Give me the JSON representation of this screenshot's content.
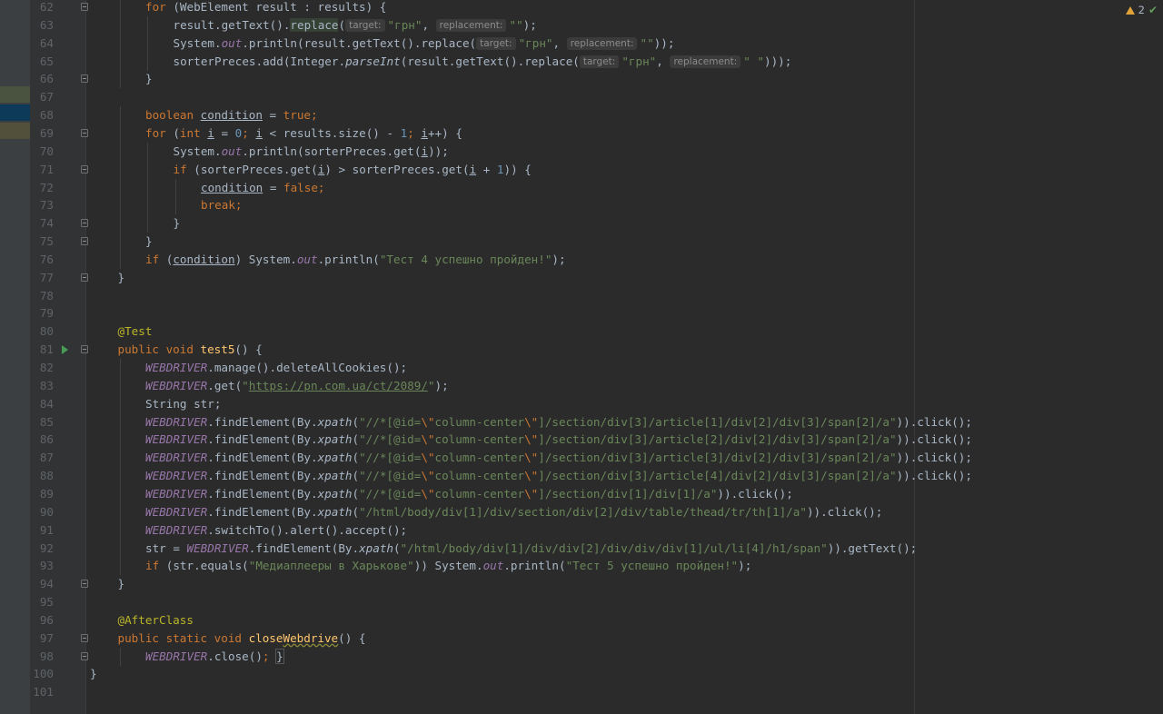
{
  "status": {
    "warnings_count": "2",
    "warning_icon": "warning-triangle-icon",
    "check_icon": "check-icon"
  },
  "colors": {
    "keyword": "#cc7832",
    "string": "#6a8759",
    "number": "#6897bb",
    "annotation": "#bbb529",
    "method_decl": "#ffc66d",
    "static_field": "#9876aa",
    "text": "#a9b7c6",
    "line_number": "#606366",
    "background": "#2b2b2b"
  },
  "hints": {
    "target": "target:",
    "replacement": "replacement:"
  },
  "lines": [
    {
      "num": "62",
      "indent": 2,
      "tokens": [
        [
          "k",
          "for"
        ],
        [
          "t",
          " (WebElement result : results) {"
        ]
      ]
    },
    {
      "num": "63",
      "indent": 3,
      "tokens": [
        [
          "t",
          "result.getText()."
        ],
        [
          "hl",
          "replace"
        ],
        [
          "t",
          "("
        ],
        [
          "hint",
          "target:"
        ],
        [
          "s",
          "\"грн\""
        ],
        [
          "t",
          ", "
        ],
        [
          "hint",
          "replacement:"
        ],
        [
          "s",
          "\"\""
        ],
        [
          "t",
          ");"
        ]
      ]
    },
    {
      "num": "64",
      "indent": 3,
      "tokens": [
        [
          "t",
          "System."
        ],
        [
          "si",
          "out"
        ],
        [
          "t",
          ".println(result.getText().replace("
        ],
        [
          "hint",
          "target:"
        ],
        [
          "s",
          "\"грн\""
        ],
        [
          "t",
          ", "
        ],
        [
          "hint",
          "replacement:"
        ],
        [
          "s",
          "\"\""
        ],
        [
          "t",
          "));"
        ]
      ]
    },
    {
      "num": "65",
      "indent": 3,
      "tokens": [
        [
          "t",
          "sorterPreces.add(Integer."
        ],
        [
          "fi",
          "parseInt"
        ],
        [
          "t",
          "(result.getText().replace("
        ],
        [
          "hint",
          "target:"
        ],
        [
          "s",
          "\"грн\""
        ],
        [
          "t",
          ", "
        ],
        [
          "hint",
          "replacement:"
        ],
        [
          "s",
          "\" \""
        ],
        [
          "t",
          ")));"
        ]
      ]
    },
    {
      "num": "66",
      "indent": 2,
      "tokens": [
        [
          "t",
          "}"
        ]
      ]
    },
    {
      "num": "67",
      "indent": 0,
      "tokens": []
    },
    {
      "num": "68",
      "indent": 2,
      "tokens": [
        [
          "k",
          "boolean "
        ],
        [
          "u",
          "condition"
        ],
        [
          "t",
          " = "
        ],
        [
          "k",
          "true"
        ],
        [
          "k",
          ";"
        ]
      ]
    },
    {
      "num": "69",
      "indent": 2,
      "tokens": [
        [
          "k",
          "for"
        ],
        [
          "t",
          " ("
        ],
        [
          "k",
          "int "
        ],
        [
          "u",
          "i"
        ],
        [
          "t",
          " = "
        ],
        [
          "n",
          "0"
        ],
        [
          "k",
          "; "
        ],
        [
          "u",
          "i"
        ],
        [
          "t",
          " < results.size() - "
        ],
        [
          "n",
          "1"
        ],
        [
          "k",
          "; "
        ],
        [
          "u",
          "i"
        ],
        [
          "t",
          "++) {"
        ]
      ]
    },
    {
      "num": "70",
      "indent": 3,
      "tokens": [
        [
          "t",
          "System."
        ],
        [
          "si",
          "out"
        ],
        [
          "t",
          ".println(sorterPreces.get("
        ],
        [
          "u",
          "i"
        ],
        [
          "t",
          "));"
        ]
      ]
    },
    {
      "num": "71",
      "indent": 3,
      "tokens": [
        [
          "k",
          "if"
        ],
        [
          "t",
          " (sorterPreces.get("
        ],
        [
          "u",
          "i"
        ],
        [
          "t",
          ") > sorterPreces.get("
        ],
        [
          "u",
          "i"
        ],
        [
          "t",
          " + "
        ],
        [
          "n",
          "1"
        ],
        [
          "t",
          ")) {"
        ]
      ]
    },
    {
      "num": "72",
      "indent": 4,
      "tokens": [
        [
          "u",
          "condition"
        ],
        [
          "t",
          " = "
        ],
        [
          "k",
          "false"
        ],
        [
          "k",
          ";"
        ]
      ]
    },
    {
      "num": "73",
      "indent": 4,
      "tokens": [
        [
          "k",
          "break;"
        ]
      ]
    },
    {
      "num": "74",
      "indent": 3,
      "tokens": [
        [
          "t",
          "}"
        ]
      ]
    },
    {
      "num": "75",
      "indent": 2,
      "tokens": [
        [
          "t",
          "}"
        ]
      ]
    },
    {
      "num": "76",
      "indent": 2,
      "tokens": [
        [
          "k",
          "if"
        ],
        [
          "t",
          " ("
        ],
        [
          "u",
          "condition"
        ],
        [
          "t",
          ") System."
        ],
        [
          "si",
          "out"
        ],
        [
          "t",
          ".println("
        ],
        [
          "s",
          "\"Тест 4 успешно пройден!\""
        ],
        [
          "t",
          ");"
        ]
      ]
    },
    {
      "num": "77",
      "indent": 1,
      "tokens": [
        [
          "t",
          "}"
        ]
      ]
    },
    {
      "num": "78",
      "indent": 0,
      "tokens": []
    },
    {
      "num": "79",
      "indent": 0,
      "tokens": []
    },
    {
      "num": "80",
      "indent": 1,
      "tokens": [
        [
          "a",
          "@Test"
        ]
      ]
    },
    {
      "num": "81",
      "indent": 1,
      "run": true,
      "tokens": [
        [
          "k",
          "public void "
        ],
        [
          "f",
          "test5"
        ],
        [
          "t",
          "() {"
        ]
      ]
    },
    {
      "num": "82",
      "indent": 2,
      "tokens": [
        [
          "si",
          "WEBDRIVER"
        ],
        [
          "t",
          ".manage().deleteAllCookies();"
        ]
      ]
    },
    {
      "num": "83",
      "indent": 2,
      "tokens": [
        [
          "si",
          "WEBDRIVER"
        ],
        [
          "t",
          ".get("
        ],
        [
          "s",
          "\""
        ],
        [
          "su",
          "https://pn.com.ua/ct/2089/"
        ],
        [
          "s",
          "\""
        ],
        [
          "t",
          ");"
        ]
      ]
    },
    {
      "num": "84",
      "indent": 2,
      "tokens": [
        [
          "t",
          "String str;"
        ]
      ]
    },
    {
      "num": "85",
      "indent": 2,
      "tokens": [
        [
          "si",
          "WEBDRIVER"
        ],
        [
          "t",
          ".findElement(By."
        ],
        [
          "fi",
          "xpath"
        ],
        [
          "t",
          "("
        ],
        [
          "s",
          "\"//*[@id="
        ],
        [
          "e",
          "\\\""
        ],
        [
          "s",
          "column-center"
        ],
        [
          "e",
          "\\\""
        ],
        [
          "s",
          "]/section/div[3]/article[1]/div[2]/div[3]/span[2]/a\""
        ],
        [
          "t",
          ")).click();"
        ]
      ]
    },
    {
      "num": "86",
      "indent": 2,
      "tokens": [
        [
          "si",
          "WEBDRIVER"
        ],
        [
          "t",
          ".findElement(By."
        ],
        [
          "fi",
          "xpath"
        ],
        [
          "t",
          "("
        ],
        [
          "s",
          "\"//*[@id="
        ],
        [
          "e",
          "\\\""
        ],
        [
          "s",
          "column-center"
        ],
        [
          "e",
          "\\\""
        ],
        [
          "s",
          "]/section/div[3]/article[2]/div[2]/div[3]/span[2]/a\""
        ],
        [
          "t",
          ")).click();"
        ]
      ]
    },
    {
      "num": "87",
      "indent": 2,
      "tokens": [
        [
          "si",
          "WEBDRIVER"
        ],
        [
          "t",
          ".findElement(By."
        ],
        [
          "fi",
          "xpath"
        ],
        [
          "t",
          "("
        ],
        [
          "s",
          "\"//*[@id="
        ],
        [
          "e",
          "\\\""
        ],
        [
          "s",
          "column-center"
        ],
        [
          "e",
          "\\\""
        ],
        [
          "s",
          "]/section/div[3]/article[3]/div[2]/div[3]/span[2]/a\""
        ],
        [
          "t",
          ")).click();"
        ]
      ]
    },
    {
      "num": "88",
      "indent": 2,
      "tokens": [
        [
          "si",
          "WEBDRIVER"
        ],
        [
          "t",
          ".findElement(By."
        ],
        [
          "fi",
          "xpath"
        ],
        [
          "t",
          "("
        ],
        [
          "s",
          "\"//*[@id="
        ],
        [
          "e",
          "\\\""
        ],
        [
          "s",
          "column-center"
        ],
        [
          "e",
          "\\\""
        ],
        [
          "s",
          "]/section/div[3]/article[4]/div[2]/div[3]/span[2]/a\""
        ],
        [
          "t",
          ")).click();"
        ]
      ]
    },
    {
      "num": "89",
      "indent": 2,
      "tokens": [
        [
          "si",
          "WEBDRIVER"
        ],
        [
          "t",
          ".findElement(By."
        ],
        [
          "fi",
          "xpath"
        ],
        [
          "t",
          "("
        ],
        [
          "s",
          "\"//*[@id="
        ],
        [
          "e",
          "\\\""
        ],
        [
          "s",
          "column-center"
        ],
        [
          "e",
          "\\\""
        ],
        [
          "s",
          "]/section/div[1]/div[1]/a\""
        ],
        [
          "t",
          ")).click();"
        ]
      ]
    },
    {
      "num": "90",
      "indent": 2,
      "tokens": [
        [
          "si",
          "WEBDRIVER"
        ],
        [
          "t",
          ".findElement(By."
        ],
        [
          "fi",
          "xpath"
        ],
        [
          "t",
          "("
        ],
        [
          "s",
          "\"/html/body/div[1]/div/section/div[2]/div/table/thead/tr/th[1]/a\""
        ],
        [
          "t",
          ")).click();"
        ]
      ]
    },
    {
      "num": "91",
      "indent": 2,
      "tokens": [
        [
          "si",
          "WEBDRIVER"
        ],
        [
          "t",
          ".switchTo().alert().accept();"
        ]
      ]
    },
    {
      "num": "92",
      "indent": 2,
      "tokens": [
        [
          "t",
          "str = "
        ],
        [
          "si",
          "WEBDRIVER"
        ],
        [
          "t",
          ".findElement(By."
        ],
        [
          "fi",
          "xpath"
        ],
        [
          "t",
          "("
        ],
        [
          "s",
          "\"/html/body/div[1]/div/div[2]/div/div/div[1]/ul/li[4]/h1/span\""
        ],
        [
          "t",
          ")).getText();"
        ]
      ]
    },
    {
      "num": "93",
      "indent": 2,
      "tokens": [
        [
          "k",
          "if"
        ],
        [
          "t",
          " (str.equals("
        ],
        [
          "s",
          "\"Медиаплееры в Харькове\""
        ],
        [
          "t",
          ")) System."
        ],
        [
          "si",
          "out"
        ],
        [
          "t",
          ".println("
        ],
        [
          "s",
          "\"Тест 5 успешно пройден!\""
        ],
        [
          "t",
          ");"
        ]
      ]
    },
    {
      "num": "94",
      "indent": 1,
      "tokens": [
        [
          "t",
          "}"
        ]
      ]
    },
    {
      "num": "95",
      "indent": 0,
      "tokens": []
    },
    {
      "num": "96",
      "indent": 1,
      "tokens": [
        [
          "a",
          "@AfterClass"
        ]
      ]
    },
    {
      "num": "97",
      "indent": 1,
      "tokens": [
        [
          "k",
          "public static void "
        ],
        [
          "f",
          "close"
        ],
        [
          "fw",
          "Webdrive"
        ],
        [
          "t",
          "() {"
        ]
      ]
    },
    {
      "num": "98",
      "indent": 2,
      "tokens": [
        [
          "si",
          "WEBDRIVER"
        ],
        [
          "t",
          ".close()"
        ],
        [
          "k",
          "; "
        ],
        [
          "box",
          "}"
        ]
      ]
    },
    {
      "num": "100",
      "indent": 0,
      "tokens": [
        [
          "t",
          "}"
        ]
      ]
    },
    {
      "num": "101",
      "indent": 0,
      "tokens": []
    }
  ]
}
